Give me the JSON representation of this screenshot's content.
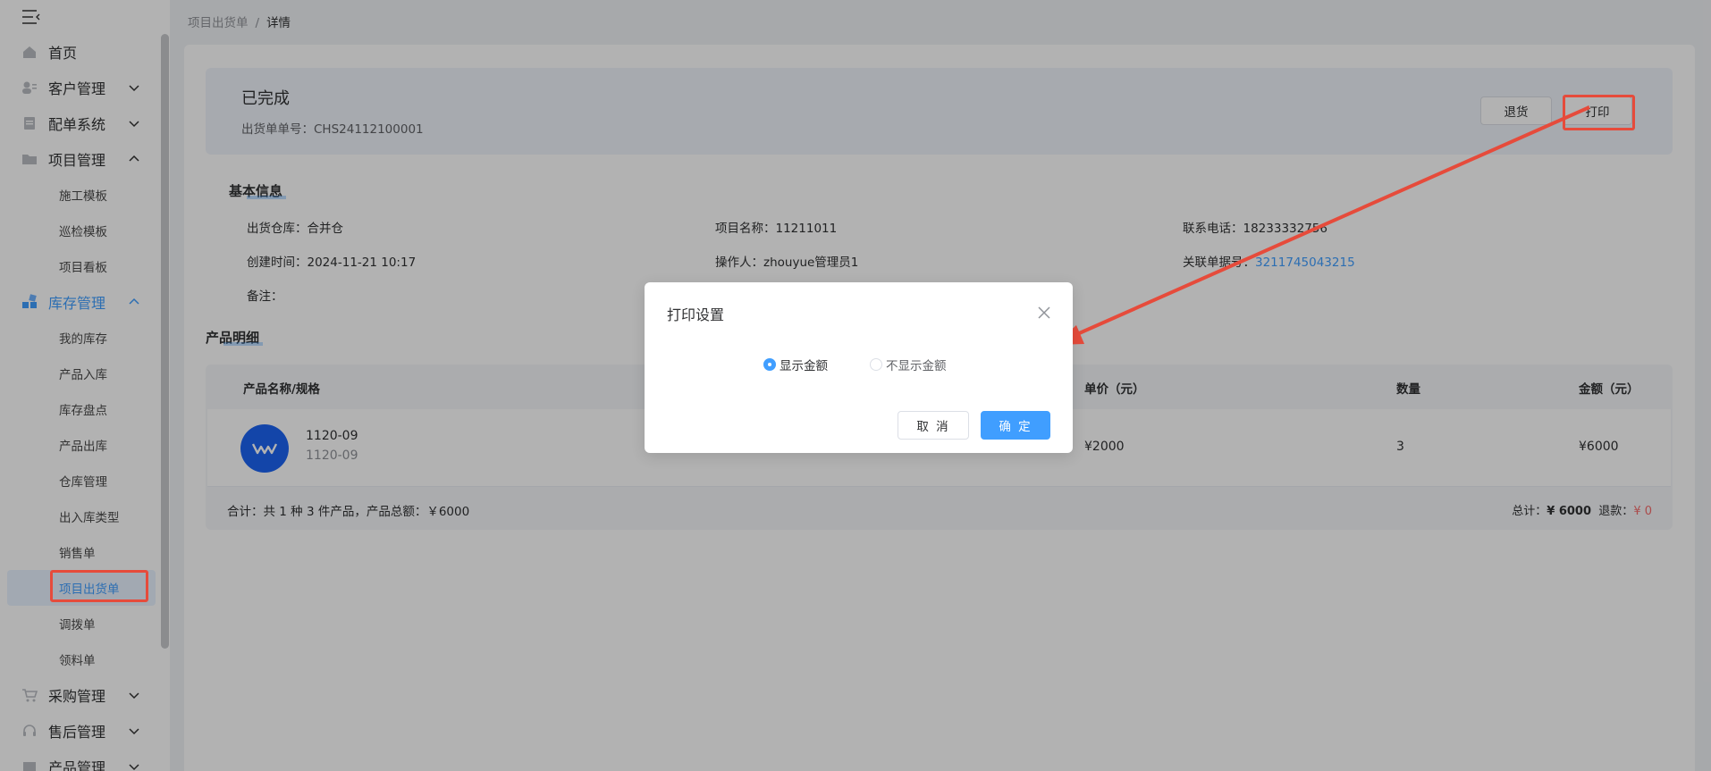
{
  "sidebar": {
    "menu": [
      {
        "label": "首页",
        "icon": "home-icon"
      },
      {
        "label": "客户管理",
        "icon": "user-card-icon",
        "caret": "down"
      },
      {
        "label": "配单系统",
        "icon": "document-icon",
        "caret": "down"
      },
      {
        "label": "项目管理",
        "icon": "folder-icon",
        "caret": "up"
      },
      {
        "label": "库存管理",
        "icon": "inventory-icon",
        "caret": "up"
      },
      {
        "label": "采购管理",
        "icon": "cart-icon",
        "caret": "down"
      },
      {
        "label": "售后管理",
        "icon": "headset-icon",
        "caret": "down"
      },
      {
        "label": "产品管理",
        "icon": "box-icon",
        "caret": "down"
      }
    ],
    "project_sub": [
      "施工模板",
      "巡检模板",
      "项目看板"
    ],
    "inventory_sub": [
      "我的库存",
      "产品入库",
      "库存盘点",
      "产品出库",
      "仓库管理",
      "出入库类型",
      "销售单",
      "项目出货单",
      "调拨单",
      "领料单"
    ]
  },
  "breadcrumb": {
    "parent": "项目出货单",
    "separator": "/",
    "current": "详情"
  },
  "header": {
    "status": "已完成",
    "order_no": "出货单单号：CHS24112100001",
    "return_button": "退货",
    "print_button": "打印"
  },
  "basic_info": {
    "title": "基本信息",
    "warehouse_label": "出货仓库：",
    "warehouse_value": "合并仓",
    "project_label": "项目名称：",
    "project_value": "11211011",
    "phone_label": "联系电话：",
    "phone_value": "18233332756",
    "created_label": "创建时间：",
    "created_value": "2024-11-21 10:17",
    "operator_label": "操作人：",
    "operator_value": "zhouyue管理员1",
    "related_label": "关联单据号：",
    "related_value": "3211745043215",
    "remark_label": "备注："
  },
  "products": {
    "title": "产品明细",
    "columns": {
      "name": "产品名称/规格",
      "price": "单价（元）",
      "qty": "数量",
      "amount": "金额（元）"
    },
    "rows": [
      {
        "name": "1120-09",
        "spec": "1120-09",
        "price": "¥2000",
        "qty": "3",
        "amount": "¥6000"
      }
    ],
    "summary_left": "合计：共 1 种 3 件产品，产品总额：￥6000",
    "total_label": "总计：",
    "total_value": "¥ 6000",
    "refund_label": "退款：",
    "refund_value": "¥ 0"
  },
  "dialog": {
    "title": "打印设置",
    "option_show": "显示金额",
    "option_hide": "不显示金额",
    "selected": "显示金额",
    "cancel": "取 消",
    "confirm": "确 定"
  },
  "colors": {
    "accent": "#409eff",
    "annotation_red": "#e64b3b",
    "refund_red": "#f56c6c"
  }
}
